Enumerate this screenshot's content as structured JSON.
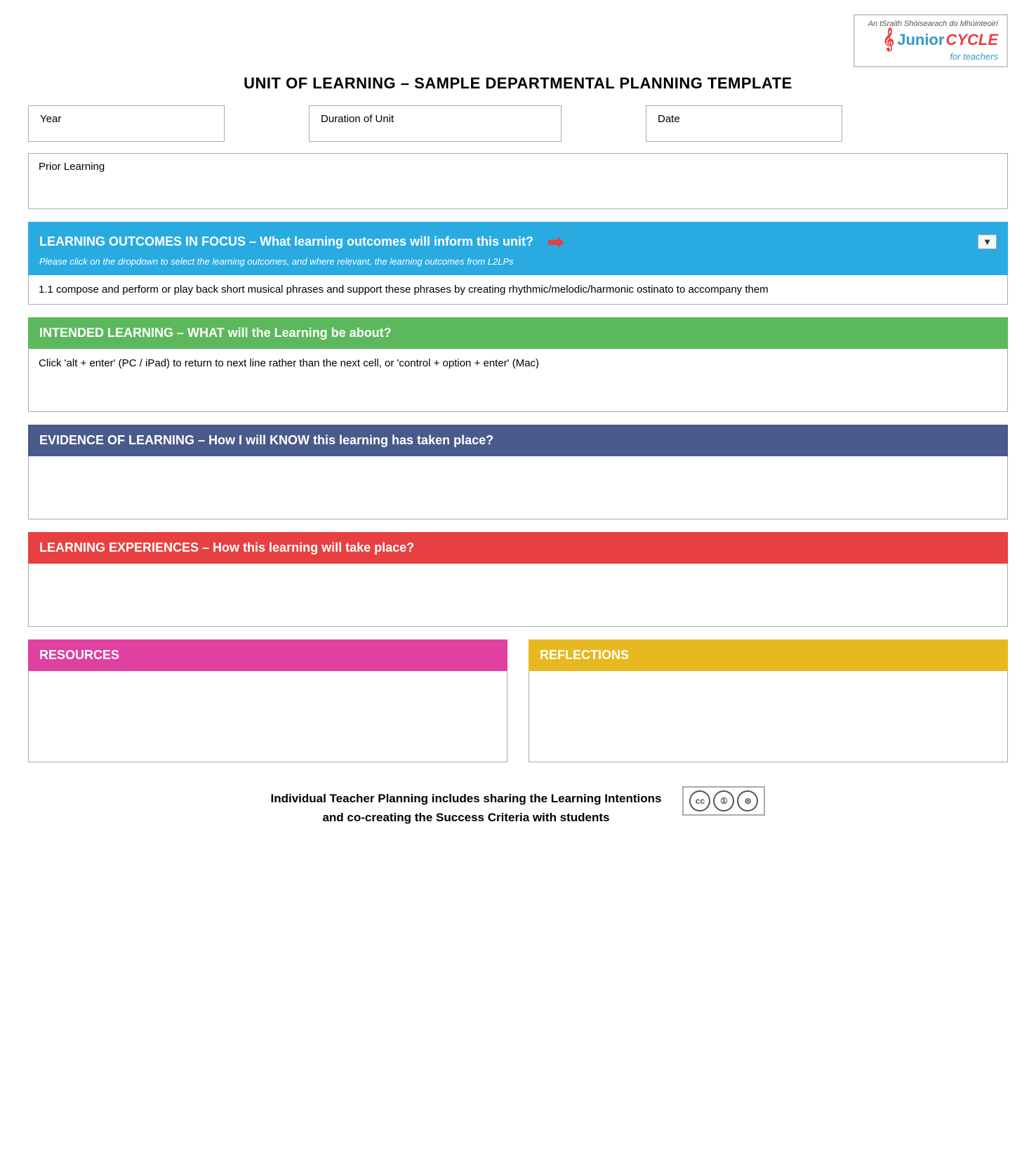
{
  "logo": {
    "small_text": "An tSraith Shóisearach do Mhúinteoirí",
    "junior": "Junior",
    "cycle": "CYCLE",
    "for_teachers": "for teachers",
    "clef": "𝄞"
  },
  "page_title": "UNIT OF LEARNING – SAMPLE DEPARTMENTAL PLANNING TEMPLATE",
  "fields": {
    "year_label": "Year",
    "duration_label": "Duration of Unit",
    "date_label": "Date"
  },
  "prior_learning": {
    "label": "Prior Learning"
  },
  "learning_outcomes": {
    "header": "LEARNING OUTCOMES IN FOCUS – What learning outcomes will inform this unit?",
    "sub_text": "Please  click on the dropdown to select the learning outcomes, and where relevant, the learning outcomes from L2LPs",
    "arrow": "➡",
    "dropdown_icon": "▼",
    "content": "1.1 compose and perform or play back short musical phrases and support these phrases by creating rhythmic/melodic/harmonic ostinato to accompany them"
  },
  "intended_learning": {
    "header": "INTENDED LEARNING – WHAT will the Learning be about?",
    "content": "Click 'alt + enter' (PC / iPad) to return to next line rather than the next cell, or 'control + option + enter' (Mac)"
  },
  "evidence_of_learning": {
    "header": "EVIDENCE OF LEARNING – How I will KNOW this learning has taken place?",
    "content": ""
  },
  "learning_experiences": {
    "header": "LEARNING EXPERIENCES – How this learning will take place?",
    "content": ""
  },
  "resources": {
    "header": "RESOURCES",
    "content": ""
  },
  "reflections": {
    "header": "REFLECTIONS",
    "content": ""
  },
  "footer": {
    "line1": "Individual Teacher Planning includes sharing the Learning Intentions",
    "line2": "and co-creating the Success Criteria with students"
  }
}
